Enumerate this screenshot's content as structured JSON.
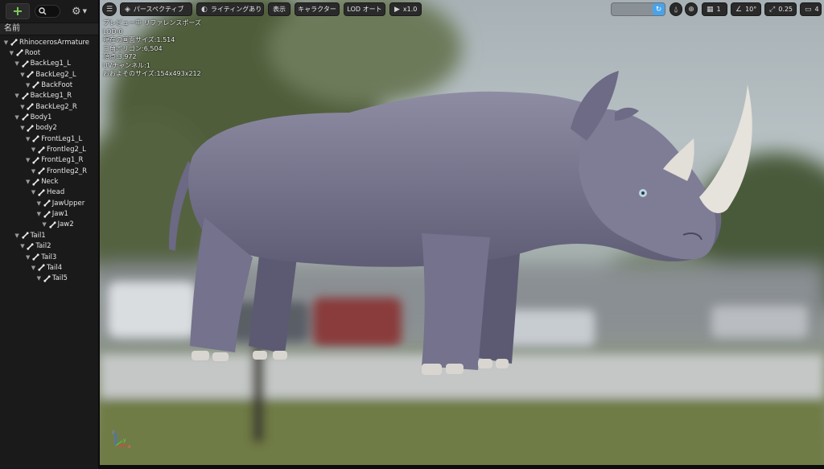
{
  "outliner": {
    "add_label": "+",
    "column_header": "名前",
    "bones": [
      {
        "label": "RhinocerosArmature",
        "depth": 0
      },
      {
        "label": "Root",
        "depth": 1
      },
      {
        "label": "BackLeg1_L",
        "depth": 2
      },
      {
        "label": "BackLeg2_L",
        "depth": 3
      },
      {
        "label": "BackFoot",
        "depth": 4
      },
      {
        "label": "BackLeg1_R",
        "depth": 2
      },
      {
        "label": "BackLeg2_R",
        "depth": 3
      },
      {
        "label": "Body1",
        "depth": 2
      },
      {
        "label": "body2",
        "depth": 3
      },
      {
        "label": "FrontLeg1_L",
        "depth": 4
      },
      {
        "label": "Frontleg2_L",
        "depth": 5
      },
      {
        "label": "FrontLeg1_R",
        "depth": 4
      },
      {
        "label": "Frontleg2_R",
        "depth": 5
      },
      {
        "label": "Neck",
        "depth": 4
      },
      {
        "label": "Head",
        "depth": 5
      },
      {
        "label": "JawUpper",
        "depth": 6
      },
      {
        "label": "Jaw1",
        "depth": 6
      },
      {
        "label": "Jaw2",
        "depth": 7
      },
      {
        "label": "Tail1",
        "depth": 2
      },
      {
        "label": "Tail2",
        "depth": 3
      },
      {
        "label": "Tail3",
        "depth": 4
      },
      {
        "label": "Tail4",
        "depth": 5
      },
      {
        "label": "Tail5",
        "depth": 6
      }
    ]
  },
  "viewport": {
    "toolbar": {
      "perspective": "パースペクティブ",
      "lighting": "ライティングあり",
      "show": "表示",
      "character": "キャラクター",
      "lod": "LOD オート",
      "play_speed": "x1.0",
      "grid_value": "1",
      "angle_value": "10°",
      "scale_value": "0.25",
      "camera_speed": "4"
    },
    "stats": [
      "プレビュー中 リファレンスポーズ",
      "LOD:0",
      "現在の画面サイズ:1.514",
      "三角ポリゴン:6,504",
      "頂点:3,972",
      "UVチャンネル:1",
      "おおよそのサイズ:154x493x212"
    ],
    "axis": {
      "x": "x",
      "y": "y",
      "z": "z"
    }
  },
  "colors": {
    "accent_green": "#7fd05a",
    "rhino_body": "#7c7a92",
    "horn": "#e6e2dc"
  }
}
